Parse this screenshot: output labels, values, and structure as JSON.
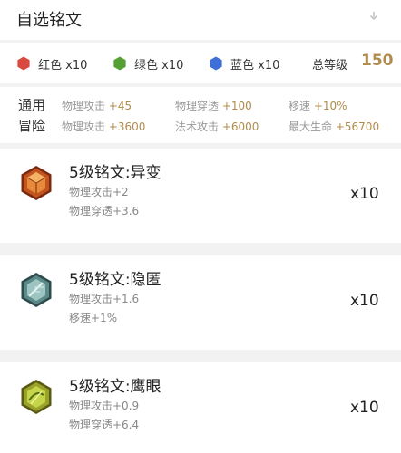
{
  "header": {
    "title": "自选铭文"
  },
  "counts": {
    "red": {
      "label": "红色 x10",
      "color": "#d84a3f"
    },
    "green": {
      "label": "绿色 x10",
      "color": "#55a032"
    },
    "blue": {
      "label": "蓝色 x10",
      "color": "#3e6fd6"
    },
    "level_label": "总等级",
    "level_value": "150"
  },
  "stats": {
    "general": {
      "mode": "通用",
      "items": [
        {
          "name": "物理攻击",
          "value": "+45"
        },
        {
          "name": "物理穿透",
          "value": "+100"
        },
        {
          "name": "移速",
          "value": "+10%"
        }
      ]
    },
    "adventure": {
      "mode": "冒险",
      "items": [
        {
          "name": "物理攻击",
          "value": "+3600"
        },
        {
          "name": "法术攻击",
          "value": "+6000"
        },
        {
          "name": "最大生命",
          "value": "+56700"
        }
      ]
    }
  },
  "runes": [
    {
      "name": "5级铭文:异变",
      "attr1": "物理攻击+2",
      "attr2": "物理穿透+3.6",
      "qty": "x10",
      "icon": "red-rune-icon"
    },
    {
      "name": "5级铭文:隐匿",
      "attr1": "物理攻击+1.6",
      "attr2": "移速+1%",
      "qty": "x10",
      "icon": "blue-rune-icon"
    },
    {
      "name": "5级铭文:鹰眼",
      "attr1": "物理攻击+0.9",
      "attr2": "物理穿透+6.4",
      "qty": "x10",
      "icon": "green-rune-icon"
    }
  ]
}
